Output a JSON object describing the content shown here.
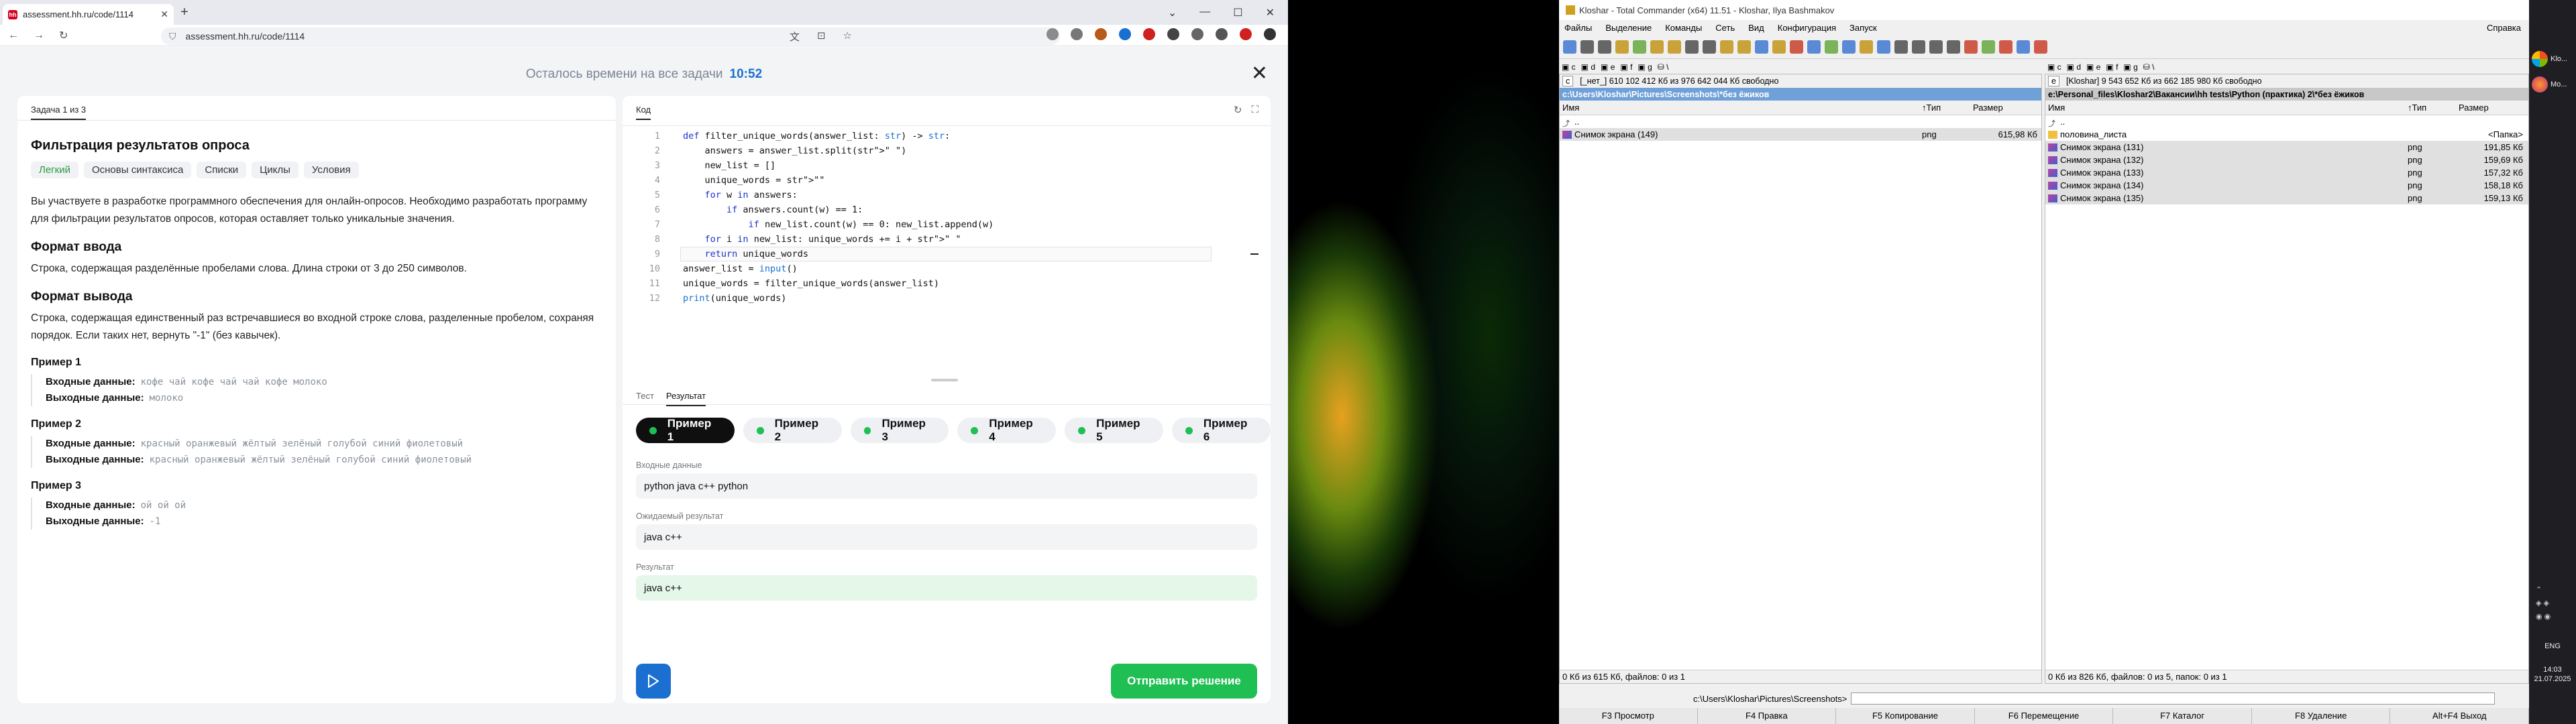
{
  "browser": {
    "tab_title": "assessment.hh.ru/code/1114",
    "tab_favicon": "hh",
    "url": "assessment.hh.ru/code/1114"
  },
  "page": {
    "timer_label": "Осталось времени на все задачи",
    "timer_value": "10:52",
    "left_tab": "Задача 1 из 3",
    "title": "Фильтрация результатов опроса",
    "tags": [
      "Легкий",
      "Основы синтаксиса",
      "Списки",
      "Циклы",
      "Условия"
    ],
    "intro": "Вы участвуете в разработке программного обеспечения для онлайн-опросов. Необходимо разработать программу для фильтрации результатов опросов, которая оставляет только уникальные значения.",
    "input_format_title": "Формат ввода",
    "input_format": "Строка, содержащая разделённые пробелами слова. Длина строки от 3 до 250 символов.",
    "output_format_title": "Формат вывода",
    "output_format": "Строка, содержащая единственный раз встречавшиеся во входной строке слова, разделенные пробелом, сохраняя порядок. Если таких нет, вернуть \"-1\" (без кавычек).",
    "input_label": "Входные данные:",
    "output_label": "Выходные данные:",
    "examples": [
      {
        "title": "Пример 1",
        "input": "кофе чай кофе чай чай кофе молоко",
        "output": "молоко"
      },
      {
        "title": "Пример 2",
        "input": "красный оранжевый жёлтый зелёный голубой синий фиолетовый",
        "output": "красный оранжевый жёлтый зелёный голубой синий фиолетовый"
      },
      {
        "title": "Пример 3",
        "input": "ой ой ой",
        "output": "-1"
      }
    ]
  },
  "editor": {
    "tab": "Код",
    "lines": [
      {
        "n": "1",
        "t": "def filter_unique_words(answer_list: str) -> str:"
      },
      {
        "n": "2",
        "t": "    answers = answer_list.split(\" \")"
      },
      {
        "n": "3",
        "t": "    new_list = []"
      },
      {
        "n": "4",
        "t": "    unique_words = \"\""
      },
      {
        "n": "5",
        "t": "    for w in answers:"
      },
      {
        "n": "6",
        "t": "        if answers.count(w) == 1:"
      },
      {
        "n": "7",
        "t": "            if new_list.count(w) == 0: new_list.append(w)"
      },
      {
        "n": "8",
        "t": "    for i in new_list: unique_words += i + \" \""
      },
      {
        "n": "9",
        "t": "    return unique_words"
      },
      {
        "n": "10",
        "t": "answer_list = input()"
      },
      {
        "n": "11",
        "t": "unique_words = filter_unique_words(answer_list)"
      },
      {
        "n": "12",
        "t": "print(unique_words)"
      }
    ]
  },
  "results": {
    "tabs": [
      "Тест",
      "Результат"
    ],
    "chips": [
      "Пример 1",
      "Пример 2",
      "Пример 3",
      "Пример 4",
      "Пример 5",
      "Пример 6"
    ],
    "input_label": "Входные данные",
    "input_value": "python java c++ python",
    "expected_label": "Ожидаемый результат",
    "expected_value": "java c++",
    "result_label": "Результат",
    "result_value": "java c++",
    "submit_label": "Отправить решение"
  },
  "tc": {
    "title": "Kloshar - Total Commander (x64) 11.51 - Kloshar, Ilya Bashmakov",
    "menu": [
      "Файлы",
      "Выделение",
      "Команды",
      "Сеть",
      "Вид",
      "Конфигурация",
      "Запуск"
    ],
    "menu_right": "Справка",
    "left": {
      "drive": "c",
      "drive_info": "[_нет_]  610 102 412 Кб из 976 642 044 Кб свободно",
      "path": "c:\\Users\\Kloshar\\Pictures\\Screenshots\\*без ёжиков",
      "col_name": "Имя",
      "col_type": "↑Тип",
      "col_size": "Размер",
      "rows": [
        {
          "name": "..",
          "type": "",
          "size": ""
        },
        {
          "name": "Снимок экрана (149)",
          "type": "png",
          "size": "615,98 Кб"
        }
      ],
      "status": "0 Кб из 615 Кб, файлов: 0 из 1"
    },
    "right": {
      "drive": "e",
      "drive_info": "[Kloshar]  9 543 652 Кб из 662 185 980 Кб свободно",
      "path": "e:\\Personal_files\\Kloshar2\\Вакансии\\hh tests\\Python (практика) 2\\*без ёжиков",
      "col_name": "Имя",
      "col_type": "↑Тип",
      "col_size": "Размер",
      "rows": [
        {
          "name": "..",
          "type": "",
          "size": ""
        },
        {
          "name": "половина_листа",
          "type": "",
          "size": "<Папка>"
        },
        {
          "name": "Снимок экрана (131)",
          "type": "png",
          "size": "191,85 Кб"
        },
        {
          "name": "Снимок экрана (132)",
          "type": "png",
          "size": "159,69 Кб"
        },
        {
          "name": "Снимок экрана (133)",
          "type": "png",
          "size": "157,32 Кб"
        },
        {
          "name": "Снимок экрана (134)",
          "type": "png",
          "size": "158,18 Кб"
        },
        {
          "name": "Снимок экрана (135)",
          "type": "png",
          "size": "159,13 Кб"
        }
      ],
      "status": "0 Кб из 826 Кб, файлов: 0 из 5, папок: 0 из 1"
    },
    "cmd_path": "c:\\Users\\Kloshar\\Pictures\\Screenshots>",
    "fkeys": [
      "F3 Просмотр",
      "F4 Правка",
      "F5 Копирование",
      "F6 Перемещение",
      "F7 Каталог",
      "F8 Удаление",
      "Alt+F4 Выход"
    ]
  },
  "taskbar": {
    "item1": "Klo...",
    "item2": "Mo...",
    "lang": "ENG",
    "time": "14:03",
    "date": "21.07.2025"
  }
}
